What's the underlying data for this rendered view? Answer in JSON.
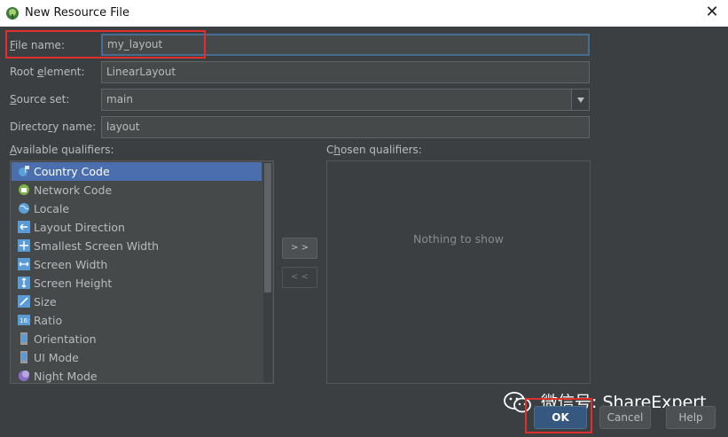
{
  "window": {
    "title": "New Resource File"
  },
  "form": {
    "file_name_label_accel": "F",
    "file_name_label_rest": "ile name:",
    "file_name_value": "my_layout",
    "root_element_label_pre": "Root ",
    "root_element_label_accel": "e",
    "root_element_label_rest": "lement:",
    "root_element_value": "LinearLayout",
    "source_set_label_accel": "S",
    "source_set_label_rest": "ource set:",
    "source_set_value": "main",
    "directory_label_pre": "Directo",
    "directory_label_accel": "r",
    "directory_label_rest": "y name:",
    "directory_value": "layout"
  },
  "qualifiers": {
    "available_label_accel": "A",
    "available_label_rest": "vailable qualifiers:",
    "chosen_label_pre": "C",
    "chosen_label_accel": "h",
    "chosen_label_rest": "osen qualifiers:",
    "items": [
      {
        "label": "Country Code",
        "icon": "globe-flag-icon",
        "selected": true
      },
      {
        "label": "Network Code",
        "icon": "network-icon",
        "selected": false
      },
      {
        "label": "Locale",
        "icon": "globe-icon",
        "selected": false
      },
      {
        "label": "Layout Direction",
        "icon": "layout-direction-icon",
        "selected": false
      },
      {
        "label": "Smallest Screen Width",
        "icon": "smallest-width-icon",
        "selected": false
      },
      {
        "label": "Screen Width",
        "icon": "screen-width-icon",
        "selected": false
      },
      {
        "label": "Screen Height",
        "icon": "screen-height-icon",
        "selected": false
      },
      {
        "label": "Size",
        "icon": "size-icon",
        "selected": false
      },
      {
        "label": "Ratio",
        "icon": "ratio-icon",
        "selected": false
      },
      {
        "label": "Orientation",
        "icon": "orientation-icon",
        "selected": false
      },
      {
        "label": "UI Mode",
        "icon": "ui-mode-icon",
        "selected": false
      },
      {
        "label": "Night Mode",
        "icon": "night-mode-icon",
        "selected": false
      }
    ],
    "add_label": "> >",
    "remove_label": "< <",
    "empty_text": "Nothing to show"
  },
  "buttons": {
    "ok": "OK",
    "cancel": "Cancel",
    "help": "Help"
  },
  "watermark": {
    "text": "微信号: ShareExpert"
  },
  "colors": {
    "dialog_bg": "#3c3f41",
    "selection": "#4b6eaf",
    "highlight_box": "#e0302e",
    "ok_button": "#365880"
  }
}
